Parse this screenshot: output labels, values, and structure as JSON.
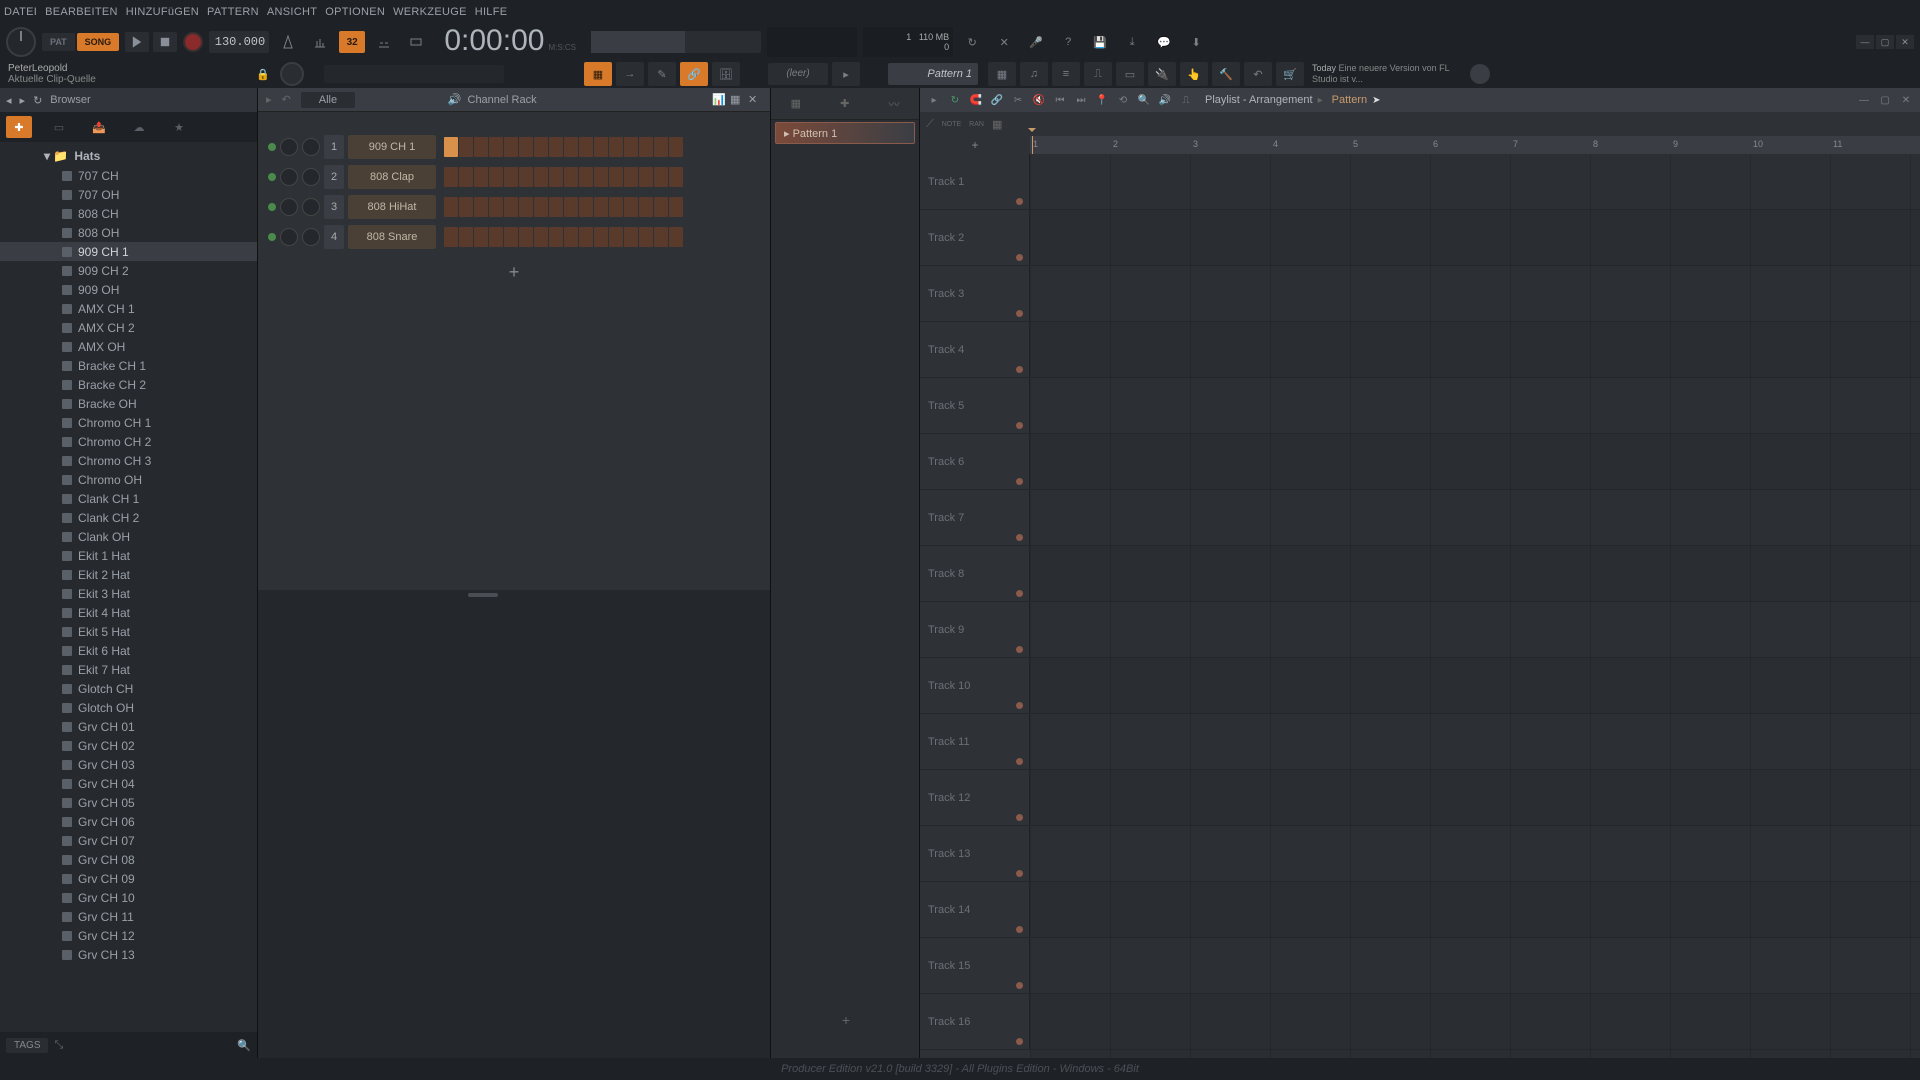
{
  "menu": [
    "DATEI",
    "BEARBEITEN",
    "HINZUFüGEN",
    "PATTERN",
    "ANSICHT",
    "OPTIONEN",
    "WERKZEUGE",
    "HILFE"
  ],
  "pat_song": {
    "pat": "PAT",
    "song": "SONG"
  },
  "tempo": "130.000",
  "snap_label": "32",
  "time": {
    "big": "0:00:",
    "small": "00",
    "suffix": "M:S:CS"
  },
  "cpu": {
    "line1": "1",
    "mem": "110 MB",
    "line2": "0"
  },
  "hint": {
    "name": "PeterLeopold",
    "sub": "Aktuelle Clip-Quelle"
  },
  "leer": "(leer)",
  "pattern_selector": "Pattern 1",
  "news": {
    "date": "Today",
    "text": "Eine neuere Version von FL Studio ist v..."
  },
  "browser": {
    "title": "Browser",
    "folder": "Hats",
    "items": [
      "707 CH",
      "707 OH",
      "808 CH",
      "808 OH",
      "909 CH 1",
      "909 CH 2",
      "909 OH",
      "AMX CH 1",
      "AMX CH 2",
      "AMX OH",
      "Bracke CH 1",
      "Bracke CH 2",
      "Bracke OH",
      "Chromo CH 1",
      "Chromo CH 2",
      "Chromo CH 3",
      "Chromo OH",
      "Clank CH 1",
      "Clank CH 2",
      "Clank OH",
      "Ekit 1 Hat",
      "Ekit 2 Hat",
      "Ekit 3 Hat",
      "Ekit 4 Hat",
      "Ekit 5 Hat",
      "Ekit 6 Hat",
      "Ekit 7 Hat",
      "Glotch CH",
      "Glotch OH",
      "Grv CH 01",
      "Grv CH 02",
      "Grv CH 03",
      "Grv CH 04",
      "Grv CH 05",
      "Grv CH 06",
      "Grv CH 07",
      "Grv CH 08",
      "Grv CH 09",
      "Grv CH 10",
      "Grv CH 11",
      "Grv CH 12",
      "Grv CH 13"
    ],
    "selected_index": 4,
    "tags": "TAGS"
  },
  "channel_rack": {
    "title": "Channel Rack",
    "filter": "Alle",
    "channels": [
      {
        "num": "1",
        "name": "909 CH 1"
      },
      {
        "num": "2",
        "name": "808 Clap"
      },
      {
        "num": "3",
        "name": "808 HiHat"
      },
      {
        "num": "4",
        "name": "808 Snare"
      }
    ],
    "add": "+"
  },
  "pattern_picker": {
    "items": [
      "Pattern 1"
    ],
    "add": "+"
  },
  "playlist": {
    "title": "Playlist - Arrangement",
    "current": "Pattern",
    "tool_note": "NOTE",
    "tool_ran": "RAN",
    "bars": [
      "1",
      "2",
      "3",
      "4",
      "5",
      "6",
      "7",
      "8",
      "9",
      "10",
      "11"
    ],
    "tracks": [
      "Track 1",
      "Track 2",
      "Track 3",
      "Track 4",
      "Track 5",
      "Track 6",
      "Track 7",
      "Track 8",
      "Track 9",
      "Track 10",
      "Track 11",
      "Track 12",
      "Track 13",
      "Track 14",
      "Track 15",
      "Track 16"
    ],
    "add": "+"
  },
  "status": "Producer Edition v21.0 [build 3329] - All Plugins Edition - Windows - 64Bit"
}
